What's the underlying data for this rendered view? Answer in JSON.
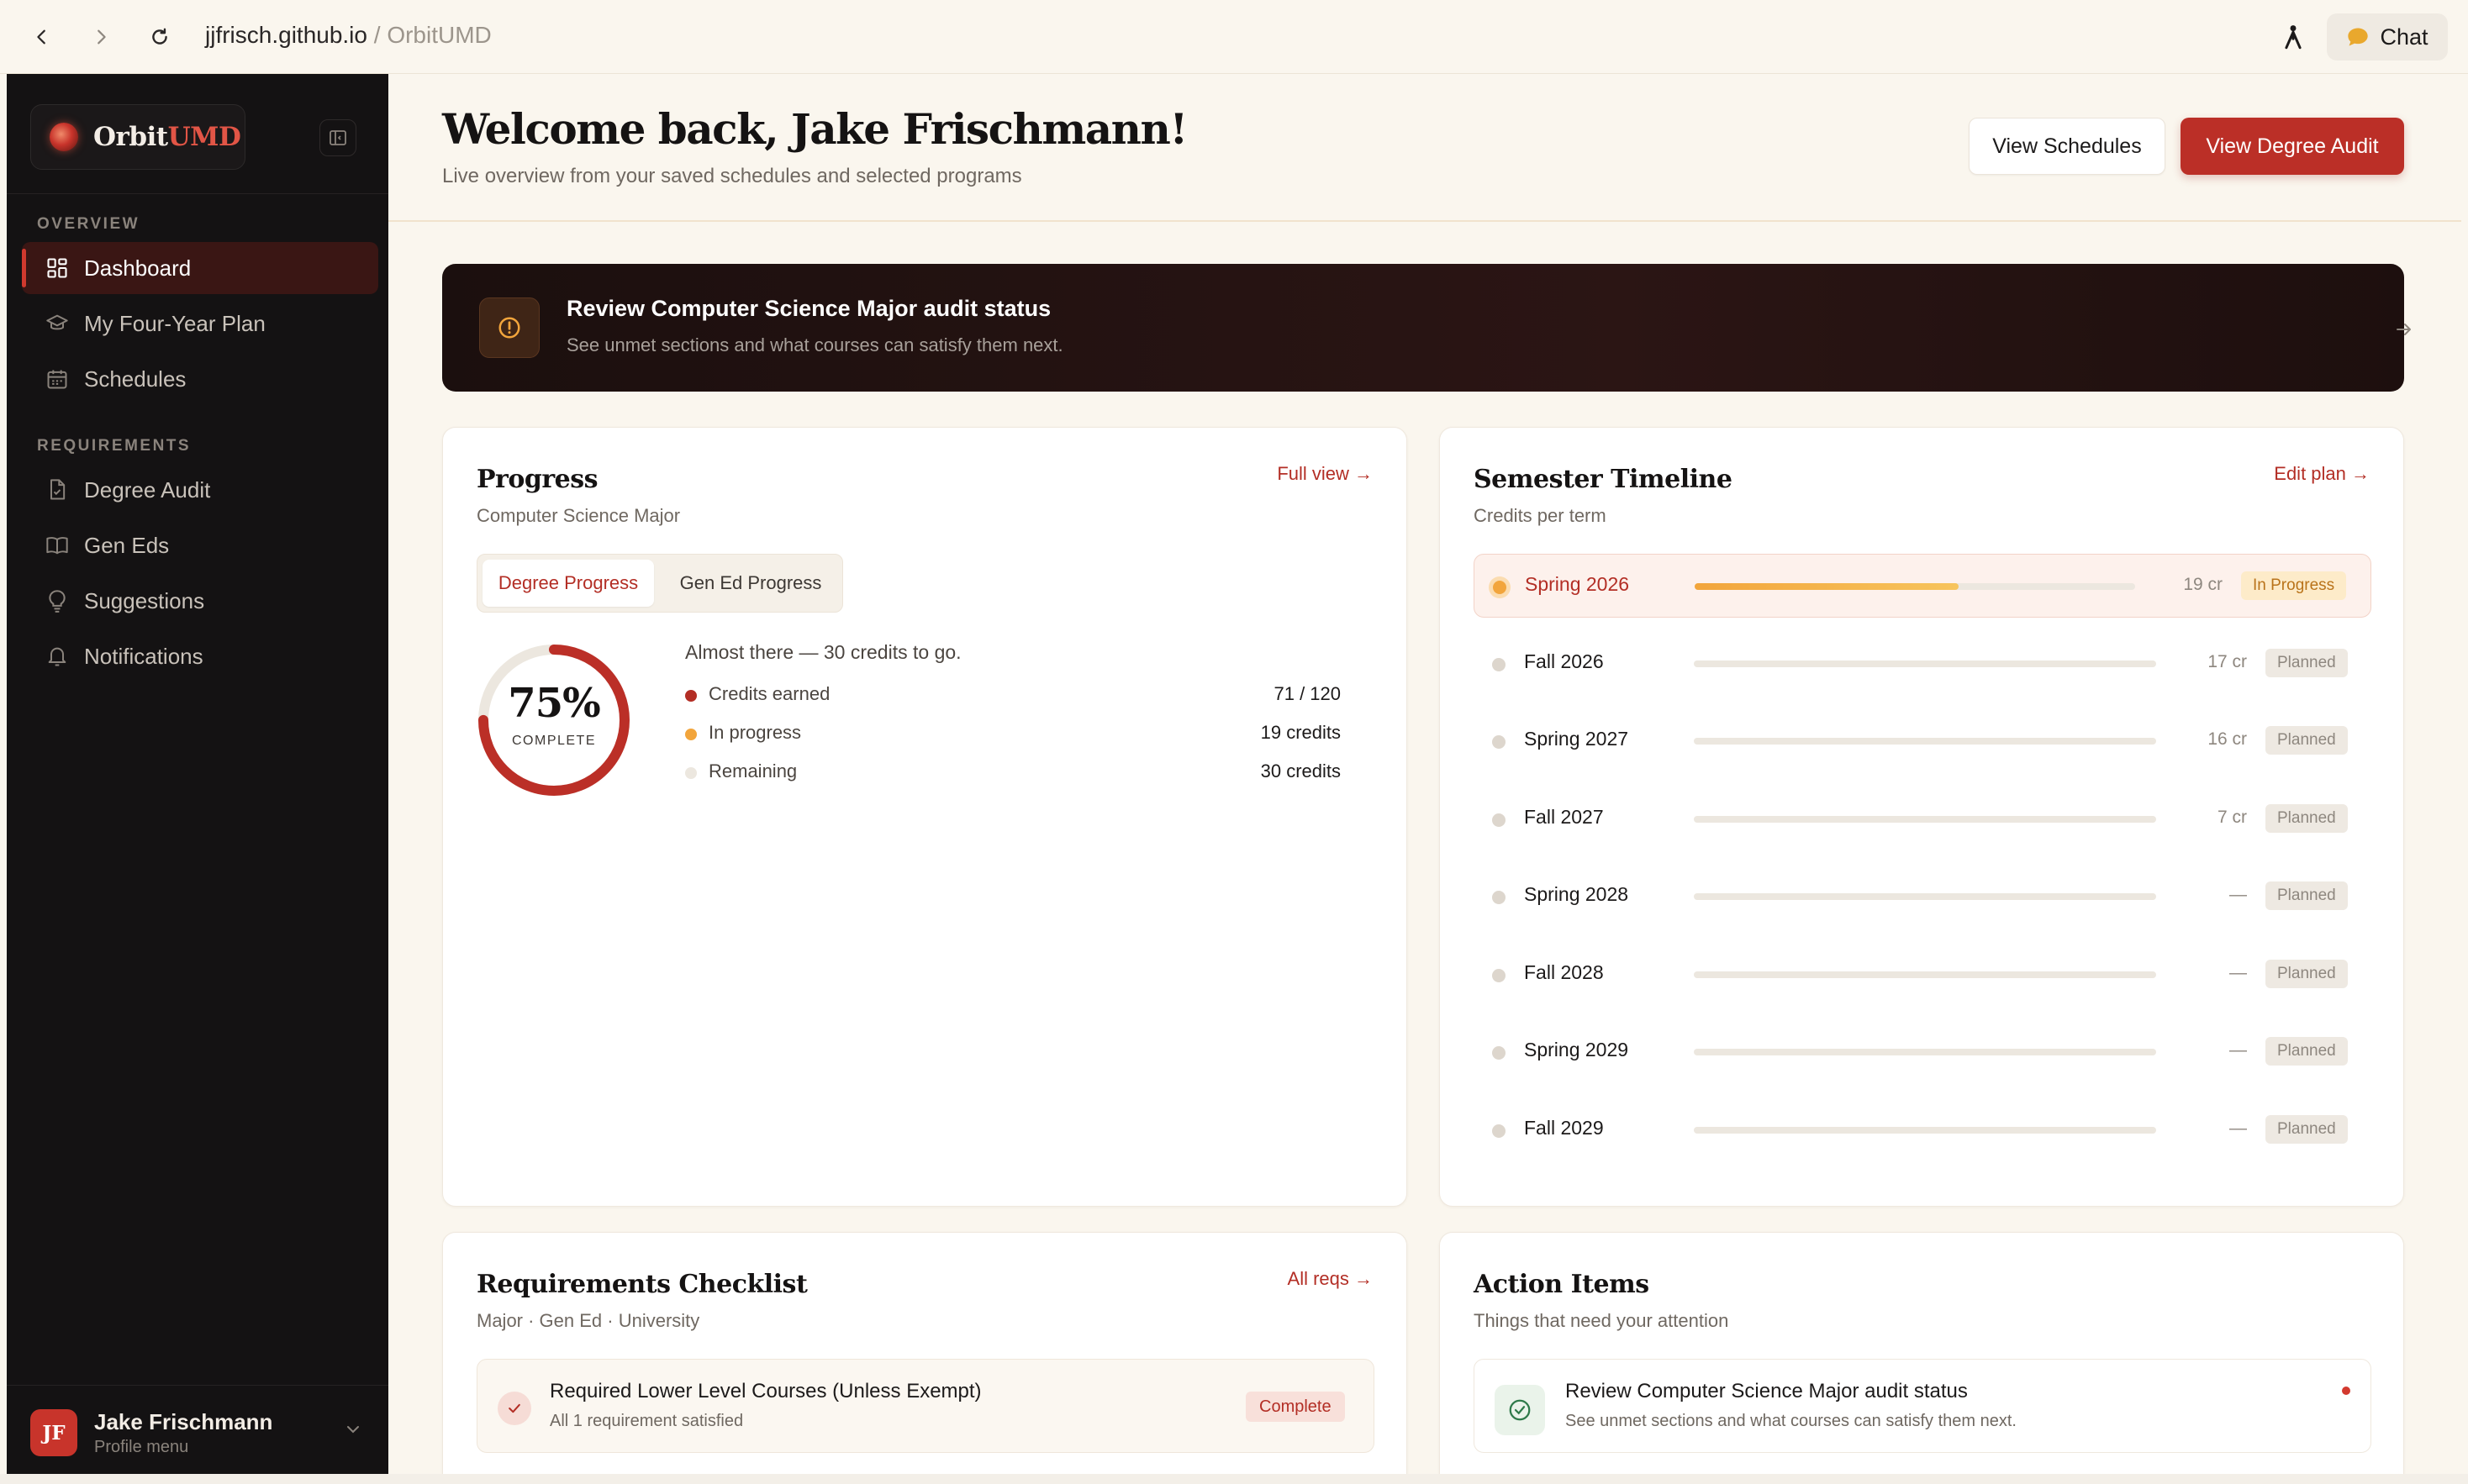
{
  "browser": {
    "url_host": "jjfrisch.github.io",
    "url_sep": " / ",
    "url_title": "OrbitUMD",
    "chat_label": "Chat"
  },
  "sidebar": {
    "brand_a": "Orbit",
    "brand_b": "UMD",
    "section_overview": "OVERVIEW",
    "section_requirements": "REQUIREMENTS",
    "items": [
      {
        "label": "Dashboard",
        "icon": "grid-icon"
      },
      {
        "label": "My Four-Year Plan",
        "icon": "graduation-cap-icon"
      },
      {
        "label": "Schedules",
        "icon": "calendar-icon"
      },
      {
        "label": "Degree Audit",
        "icon": "file-check-icon"
      },
      {
        "label": "Gen Eds",
        "icon": "book-icon"
      },
      {
        "label": "Suggestions",
        "icon": "lightbulb-icon"
      },
      {
        "label": "Notifications",
        "icon": "bell-icon"
      }
    ],
    "profile": {
      "initials": "JF",
      "name": "Jake Frischmann",
      "sub": "Profile menu"
    }
  },
  "header": {
    "title": "Welcome back, Jake Frischmann!",
    "subtitle": "Live overview from your saved schedules and selected programs",
    "btn_schedules": "View Schedules",
    "btn_audit": "View Degree Audit"
  },
  "banner": {
    "title": "Review Computer Science Major audit status",
    "subtitle": "See unmet sections and what courses can satisfy them next."
  },
  "progress": {
    "title": "Progress",
    "subtitle": "Computer Science Major",
    "link": "Full view →",
    "tab_degree": "Degree Progress",
    "tab_gened": "Gen Ed Progress",
    "percent_text": "75%",
    "percent_value": 75,
    "complete_label": "COMPLETE",
    "message": "Almost there — 30 credits to go.",
    "legend": [
      {
        "label": "Credits earned",
        "value": "71 / 120",
        "color": "#b32e25"
      },
      {
        "label": "In progress",
        "value": "19 credits",
        "color": "#f2a53c"
      },
      {
        "label": "Remaining",
        "value": "30 credits",
        "color": "#ece7df"
      }
    ]
  },
  "timeline": {
    "title": "Semester Timeline",
    "subtitle": "Credits per term",
    "link": "Edit plan →",
    "terms": [
      {
        "name": "Spring 2026",
        "credits": "19 cr",
        "status": "In Progress",
        "fill": 0.6
      },
      {
        "name": "Fall 2026",
        "credits": "17 cr",
        "status": "Planned",
        "fill": 0
      },
      {
        "name": "Spring 2027",
        "credits": "16 cr",
        "status": "Planned",
        "fill": 0
      },
      {
        "name": "Fall 2027",
        "credits": "7 cr",
        "status": "Planned",
        "fill": 0
      },
      {
        "name": "Spring 2028",
        "credits": "—",
        "status": "Planned",
        "fill": 0
      },
      {
        "name": "Fall 2028",
        "credits": "—",
        "status": "Planned",
        "fill": 0
      },
      {
        "name": "Spring 2029",
        "credits": "—",
        "status": "Planned",
        "fill": 0
      },
      {
        "name": "Fall 2029",
        "credits": "—",
        "status": "Planned",
        "fill": 0
      }
    ]
  },
  "checklist": {
    "title": "Requirements Checklist",
    "subtitle": "Major · Gen Ed · University",
    "link": "All reqs →",
    "item": {
      "title": "Required Lower Level Courses (Unless Exempt)",
      "sub": "All 1 requirement satisfied",
      "badge": "Complete"
    }
  },
  "actions": {
    "title": "Action Items",
    "subtitle": "Things that need your attention",
    "item": {
      "title": "Review Computer Science Major audit status",
      "sub": "See unmet sections and what courses can satisfy them next."
    }
  }
}
